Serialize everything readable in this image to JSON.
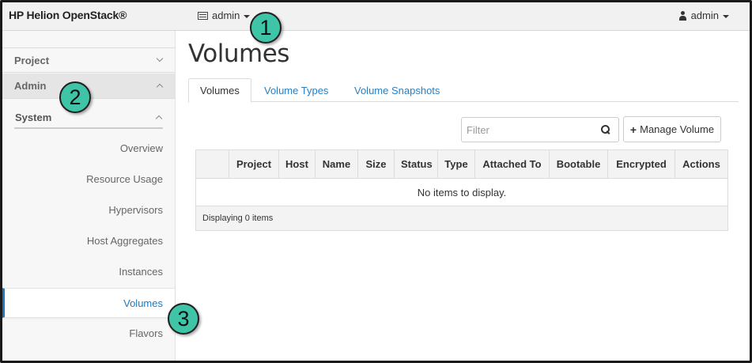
{
  "navbar": {
    "brand": "HP Helion OpenStack®",
    "project_switcher": "admin",
    "user_menu": "admin"
  },
  "sidebar": {
    "sections": [
      {
        "label": "Project",
        "state": "collapsed"
      },
      {
        "label": "Admin",
        "state": "expanded"
      }
    ],
    "group": {
      "label": "System",
      "state": "expanded"
    },
    "items": [
      {
        "label": "Overview"
      },
      {
        "label": "Resource Usage"
      },
      {
        "label": "Hypervisors"
      },
      {
        "label": "Host Aggregates"
      },
      {
        "label": "Instances"
      },
      {
        "label": "Volumes",
        "active": true
      },
      {
        "label": "Flavors"
      }
    ]
  },
  "main": {
    "title": "Volumes",
    "tabs": [
      {
        "label": "Volumes",
        "active": true
      },
      {
        "label": "Volume Types"
      },
      {
        "label": "Volume Snapshots"
      }
    ],
    "filter": {
      "placeholder": "Filter",
      "value": ""
    },
    "manage_button": "Manage Volume",
    "table": {
      "columns": [
        "",
        "Project",
        "Host",
        "Name",
        "Size",
        "Status",
        "Type",
        "Attached To",
        "Bootable",
        "Encrypted",
        "Actions"
      ],
      "empty_message": "No items to display.",
      "footer": "Displaying 0 items"
    }
  },
  "callouts": [
    "1",
    "2",
    "3"
  ],
  "colors": {
    "accent": "#1a7bc4",
    "link": "#2a7fc1",
    "callout": "#40c4a8"
  }
}
